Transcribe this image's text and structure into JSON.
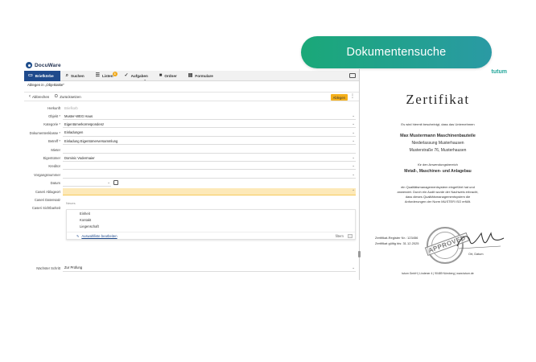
{
  "app": {
    "logo_text": "DocuWare",
    "menu": [
      {
        "label": "Briefkörbe"
      },
      {
        "label": "Suchen"
      },
      {
        "label": "Listen",
        "badge": "3"
      },
      {
        "label": "Aufgaben"
      },
      {
        "label": "Ordner"
      },
      {
        "label": "Formulare"
      }
    ],
    "breadcrumb": "Ablegen in „Objektakte\"",
    "actions": {
      "cancel": "Abbrechen",
      "reset": "Zurücksetzen",
      "file": "Ablegen"
    },
    "fields": [
      {
        "label": "Herkunft",
        "value": "Briefkorb"
      },
      {
        "label": "Objekt *",
        "value": "Muster-WEG Haus"
      },
      {
        "label": "Kategorie *",
        "value": "Eigentümerkorrespondenz"
      },
      {
        "label": "Dokumentenklasse *",
        "value": "Einladungen"
      },
      {
        "label": "Betreff *",
        "value": "Einladung Eigentümerversammlung"
      },
      {
        "label": "Mieter",
        "value": ""
      },
      {
        "label": "Eigentümer",
        "value": "Dominic Vodermaier"
      },
      {
        "label": "Kreditor",
        "value": ""
      },
      {
        "label": "Vorgangsnummer",
        "value": ""
      },
      {
        "label": "Datum",
        "value": ""
      },
      {
        "label": "Caseri Ablageort",
        "value": ""
      },
      {
        "label": "Caseri Datensatz",
        "value": ""
      },
      {
        "label": "Caseri Sichtbarkeit",
        "value": ""
      }
    ],
    "search_stub": "Neues",
    "dropdown": {
      "options": [
        "Einheit",
        "Kontakt",
        "Liegenschaft"
      ],
      "edit_label": "Auswahlliste bearbeiten",
      "filter_label": "filtern"
    },
    "next_step": {
      "label": "Nächster Schritt",
      "value": "Zur Prüfung"
    }
  },
  "certificate": {
    "brand": "tutum",
    "title": "Zertifikat",
    "intro": "Es wird hiermit bescheinigt, dass das Unternehmen",
    "company": "Max Mustermann Maschinenbauteile",
    "branch": "Niederlassung Musterhausen",
    "address": "Musterstraße 76, Musterhausen",
    "scope_intro": "für den Anwendungsbereich",
    "scope": "Metall-, Maschinen- und Anlagebau",
    "body": [
      "ein Qualitätsmanagementsystem eingeführt hat und",
      "anwendet. Durch ein Audit wurde der Nachweis erbracht,",
      "dass dieses Qualitätsmanagementsystem die",
      "Anforderungen der Norm MUSTER ISO erfüllt."
    ],
    "register": "Zertifikat-Register Nr.: 123456",
    "valid": "Zertifikat gültig bis: 31.12.2025",
    "stamp": "APPROVED",
    "place": "Ort, Datum",
    "footer": "tutum GmbH | Lindener 4 | 90489 Nürnberg | www.tutum.de"
  },
  "search_pill": "Dokumentensuche",
  "colors": {
    "menu_active": "#1f4a8c",
    "file_button": "#f5b01a",
    "highlight": "#fde9b8",
    "pill_start": "#1aa878",
    "pill_end": "#2a9aa4",
    "brand": "#22a69a"
  }
}
